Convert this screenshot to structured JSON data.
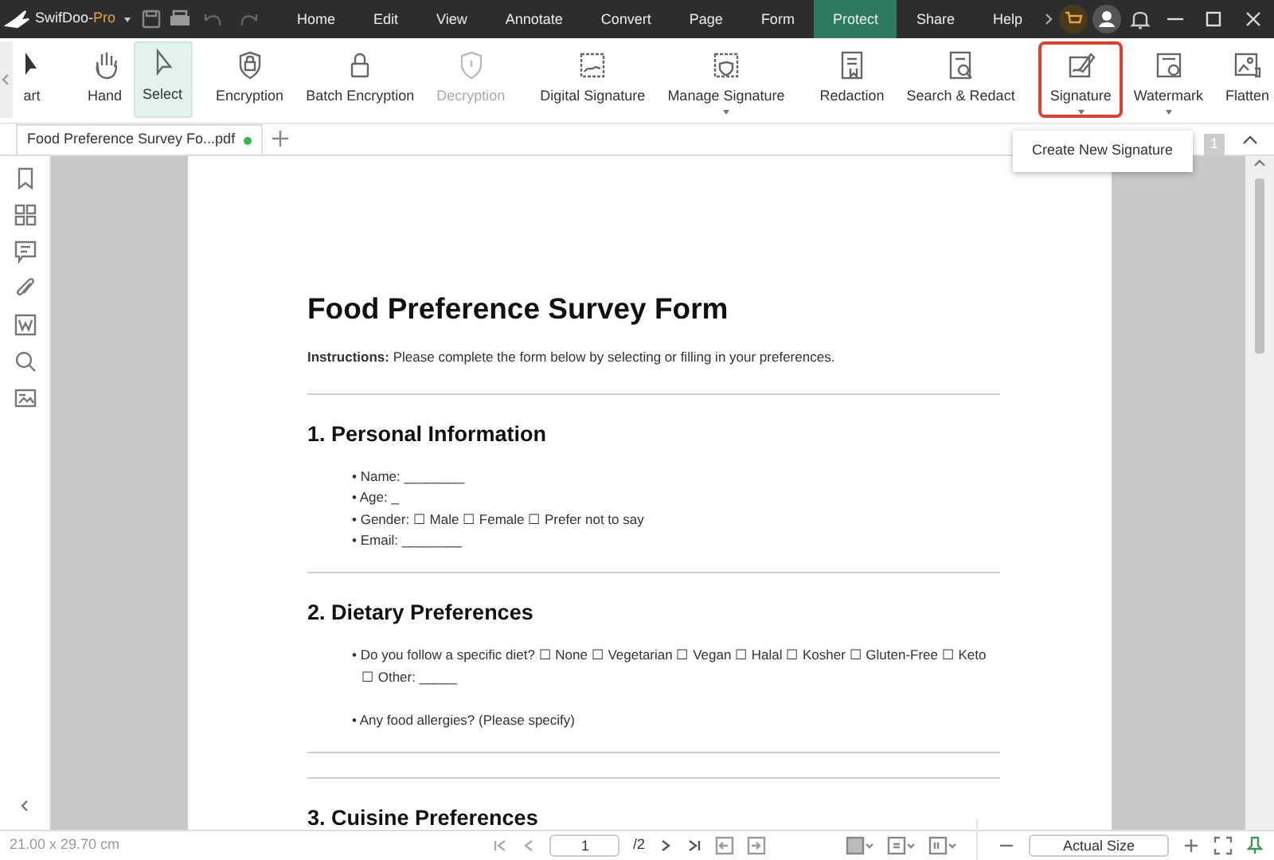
{
  "title_bar": {
    "app_name": "SwifDoo-",
    "app_edition": "Pro",
    "menu": [
      {
        "label": "Home",
        "selected": false
      },
      {
        "label": "Edit",
        "selected": false
      },
      {
        "label": "View",
        "selected": false
      },
      {
        "label": "Annotate",
        "selected": false
      },
      {
        "label": "Convert",
        "selected": false
      },
      {
        "label": "Page",
        "selected": false
      },
      {
        "label": "Form",
        "selected": false
      },
      {
        "label": "Protect",
        "selected": true
      },
      {
        "label": "Share",
        "selected": false
      },
      {
        "label": "Help",
        "selected": false
      }
    ]
  },
  "ribbon": {
    "items": [
      {
        "label": "art",
        "kind": "button",
        "selected": false,
        "disabled": false,
        "highlighted": false
      },
      {
        "label": "Hand",
        "kind": "button",
        "selected": false,
        "disabled": false,
        "highlighted": false
      },
      {
        "label": "Select",
        "kind": "button",
        "selected": true,
        "disabled": false,
        "highlighted": false
      },
      {
        "label": "Encryption",
        "kind": "button",
        "selected": false,
        "disabled": false,
        "highlighted": false
      },
      {
        "label": "Batch Encryption",
        "kind": "button",
        "selected": false,
        "disabled": false,
        "highlighted": false
      },
      {
        "label": "Decryption",
        "kind": "button",
        "selected": false,
        "disabled": true,
        "highlighted": false
      },
      {
        "label": "Digital Signature",
        "kind": "button",
        "selected": false,
        "disabled": false,
        "highlighted": false
      },
      {
        "label": "Manage Signature",
        "kind": "dropdown",
        "selected": false,
        "disabled": false,
        "highlighted": false
      },
      {
        "label": "Redaction",
        "kind": "button",
        "selected": false,
        "disabled": false,
        "highlighted": false
      },
      {
        "label": "Search & Redact",
        "kind": "button",
        "selected": false,
        "disabled": false,
        "highlighted": false
      },
      {
        "label": "Signature",
        "kind": "dropdown",
        "selected": false,
        "disabled": false,
        "highlighted": true
      },
      {
        "label": "Watermark",
        "kind": "dropdown",
        "selected": false,
        "disabled": false,
        "highlighted": false
      },
      {
        "label": "Flatten",
        "kind": "button",
        "selected": false,
        "disabled": false,
        "highlighted": false
      }
    ]
  },
  "dropdown_menu": {
    "items": [
      "Create New Signature"
    ]
  },
  "page_badge": "1",
  "document_tabs": [
    {
      "label": "Food Preference Survey Fo...pdf",
      "selected": true,
      "modified": true
    }
  ],
  "document": {
    "title": "Food Preference Survey Form",
    "instructions": "**Instructions:** Please complete the form below by selecting or filling in your preferences.",
    "sections": [
      {
        "heading": "1. Personal Information",
        "items": [
          "• Name: ________",
          "• Age: _",
          "• Gender: ☐ Male ☐ Female ☐ Prefer not to say",
          "• Email: ________"
        ]
      },
      {
        "heading": "2. Dietary Preferences",
        "items": [
          "• Do you follow a specific diet? ☐ None ☐ Vegetarian ☐ Vegan ☐ Halal ☐ Kosher ☐ Gluten-Free ☐ Keto ☐ Other: _____",
          "• Any food allergies? (Please specify)"
        ]
      },
      {
        "heading": "3. Cuisine Preferences"
      }
    ]
  },
  "status_bar": {
    "page_size": "21.00 x 29.70 cm",
    "current_page": "1",
    "page_total": "/2",
    "zoom": "Actual Size"
  }
}
